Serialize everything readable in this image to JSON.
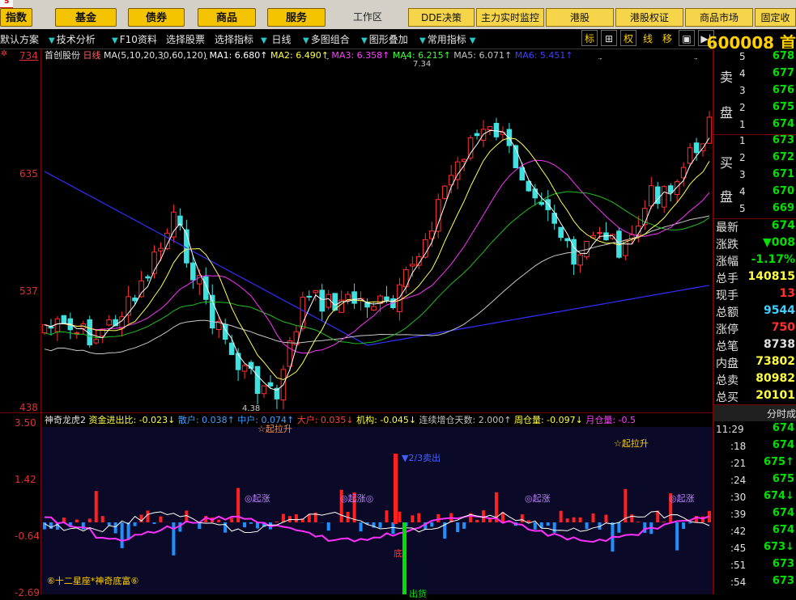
{
  "top_menu": {
    "buttons": [
      "指数",
      "基金",
      "债券",
      "商品",
      "服务"
    ],
    "work_area": "工作区",
    "right_buttons": [
      "DDE决策",
      "主力实时监控",
      "港股",
      "港股权证",
      "商品市场",
      "固定收"
    ],
    "logo_mark": "S"
  },
  "toolbar": {
    "items": [
      "默认方案",
      "技术分析",
      "F10资料",
      "选择股票",
      "选择指标",
      "日线",
      "多图组合",
      "图形叠加",
      "常用指标"
    ],
    "mode_buttons": [
      "标",
      "权",
      "线",
      "移"
    ],
    "stock_code": "600008 首"
  },
  "main_chart": {
    "stock_name": "首创股份",
    "period": "日线",
    "ma_params": "MA(5,10,20,30,60,120)",
    "ma_values": [
      {
        "label": "MA1: 6.680↑",
        "color": "#ffffff"
      },
      {
        "label": "MA2: 6.490↑",
        "color": "#ffff40"
      },
      {
        "label": "MA3: 6.358↑",
        "color": "#ff40ff"
      },
      {
        "label": "MA4: 6.215↑",
        "color": "#40ff40"
      },
      {
        "label": "MA5: 6.071↑",
        "color": "#c0c0c0"
      },
      {
        "label": "MA6: 5.451↑",
        "color": "#4040ff"
      }
    ],
    "y_ticks": [
      "734",
      "635",
      "537",
      "438"
    ],
    "high_label": "7.34",
    "low_label": "4.38"
  },
  "indicator": {
    "name": "神奇龙虎2",
    "fields": [
      {
        "label": "资金进出比: -0.023↓",
        "color": "#ffff40"
      },
      {
        "label": "散户: 0.038↑",
        "color": "#40a0ff"
      },
      {
        "label": "中户: 0.074↑",
        "color": "#40a0ff"
      },
      {
        "label": "大户: 0.035↓",
        "color": "#ff4040"
      },
      {
        "label": "机构: -0.045↓",
        "color": "#ffff40"
      },
      {
        "label": "连续增仓天数: 2.000↑",
        "color": "#c0c0c0"
      },
      {
        "label": "周仓量: -0.097↓",
        "color": "#ffff40"
      },
      {
        "label": "月仓量: -0.5",
        "color": "#ff40ff"
      }
    ],
    "y_ticks": [
      "3.50",
      "1.42",
      "-0.64",
      "-2.69"
    ],
    "annotations": {
      "up_flag_1": "☆起拉升",
      "up_flag_2": "☆起拉升",
      "rise_1": "◎起涨",
      "rise_2": "◎起涨◎",
      "rise_3": "◎起涨",
      "rise_4": "◎起涨",
      "sell": "▼2/3卖出",
      "bottom": "底",
      "footer": "⑥十二星座*神奇底富⑥",
      "out": "出货"
    }
  },
  "right_panel": {
    "sell_label": [
      "卖",
      "盘"
    ],
    "buy_label": [
      "买",
      "盘"
    ],
    "sell_orders": [
      {
        "level": "5",
        "price": "678"
      },
      {
        "level": "4",
        "price": "677"
      },
      {
        "level": "3",
        "price": "676"
      },
      {
        "level": "2",
        "price": "675"
      },
      {
        "level": "1",
        "price": "674"
      }
    ],
    "buy_orders": [
      {
        "level": "1",
        "price": "673"
      },
      {
        "level": "2",
        "price": "672"
      },
      {
        "level": "3",
        "price": "671"
      },
      {
        "level": "4",
        "price": "670"
      },
      {
        "level": "5",
        "price": "669"
      }
    ],
    "stats": [
      {
        "key": "最新",
        "value": "674",
        "color": "#00e000"
      },
      {
        "key": "涨跌",
        "value": "▼008",
        "color": "#00e000"
      },
      {
        "key": "涨幅",
        "value": "-1.17%",
        "color": "#00e000"
      },
      {
        "key": "总手",
        "value": "140815",
        "color": "#ffff40"
      },
      {
        "key": "现手",
        "value": "13",
        "color": "#ff3030"
      },
      {
        "key": "总额",
        "value": "9544",
        "color": "#40d0ff"
      },
      {
        "key": "涨停",
        "value": "750",
        "color": "#ff3030"
      },
      {
        "key": "总笔",
        "value": "8738",
        "color": "#e0e0e0"
      },
      {
        "key": "内盘",
        "value": "73802",
        "color": "#ffff40"
      },
      {
        "key": "总卖",
        "value": "80982",
        "color": "#ffff40"
      },
      {
        "key": "总买",
        "value": "20101",
        "color": "#ffff40"
      }
    ],
    "tick_header": "分时成",
    "ticks": [
      {
        "time": "11:29",
        "price": "674",
        "arrow": ""
      },
      {
        "time": ":18",
        "price": "674",
        "arrow": ""
      },
      {
        "time": ":21",
        "price": "675",
        "arrow": "↑"
      },
      {
        "time": ":24",
        "price": "675",
        "arrow": ""
      },
      {
        "time": ":30",
        "price": "674",
        "arrow": "↓"
      },
      {
        "time": ":39",
        "price": "674",
        "arrow": ""
      },
      {
        "time": ":42",
        "price": "674",
        "arrow": ""
      },
      {
        "time": ":45",
        "price": "673",
        "arrow": "↓"
      },
      {
        "time": ":51",
        "price": "673",
        "arrow": ""
      },
      {
        "time": ":54",
        "price": "673",
        "arrow": ""
      }
    ]
  }
}
